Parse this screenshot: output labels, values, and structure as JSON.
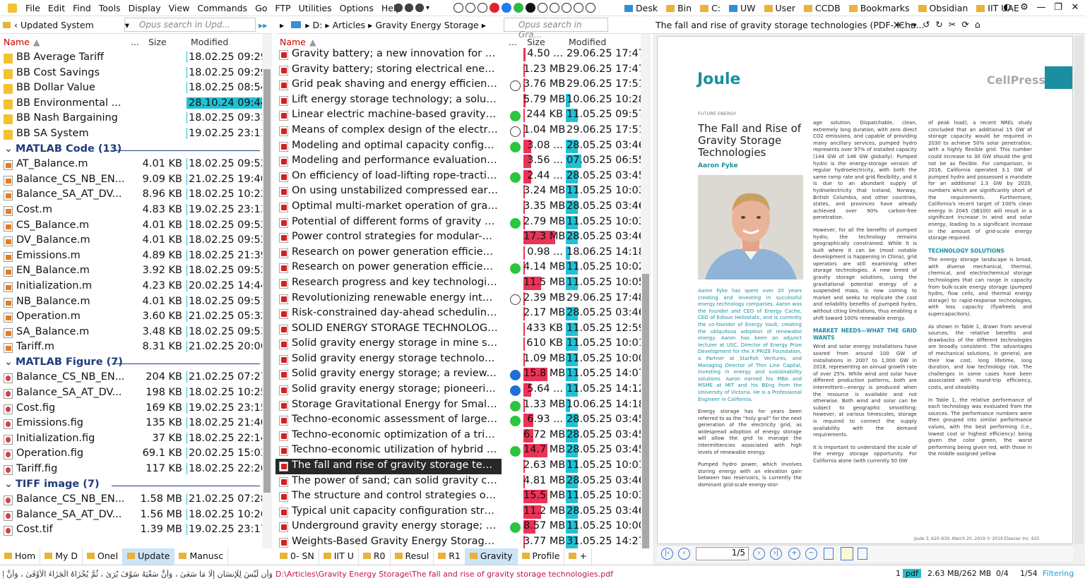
{
  "menubar": {
    "items": [
      "File",
      "Edit",
      "Find",
      "Tools",
      "Display",
      "View",
      "Commands",
      "Go",
      "FTP",
      "Utilities",
      "Options",
      "Help"
    ],
    "favorites": [
      "Desk",
      "Bin",
      "C:",
      "UW",
      "User",
      "CCDB",
      "Bookmarks",
      "Obsidian",
      "IIT UAE"
    ]
  },
  "left": {
    "breadcrumb": "Updated System",
    "search_placeholder": "Opus search in Upd...",
    "col_name": "Name",
    "col_dots": "...",
    "col_size": "Size",
    "col_modified": "Modified",
    "groups": [
      {
        "title": "",
        "rows": [
          {
            "name": "BB Average Tariff",
            "size": "",
            "mod": "18.02.25 09:29",
            "icon": "folder"
          },
          {
            "name": "BB Cost Savings",
            "size": "",
            "mod": "18.02.25 09:29",
            "icon": "folder"
          },
          {
            "name": "BB Dollar Value",
            "size": "",
            "mod": "18.02.25 08:54",
            "icon": "folder"
          },
          {
            "name": "BB Environmental ...",
            "size": "",
            "mod": "28.10.24 09:44",
            "icon": "folder",
            "hl": true
          },
          {
            "name": "BB Nash Bargaining",
            "size": "",
            "mod": "18.02.25 09:31",
            "icon": "folder"
          },
          {
            "name": "BB SA System",
            "size": "",
            "mod": "19.02.25 23:11",
            "icon": "folder"
          }
        ]
      },
      {
        "title": "MATLAB Code (13)",
        "rows": [
          {
            "name": "AT_Balance.m",
            "size": "4.01 KB",
            "mod": "18.02.25 09:52",
            "icon": "mfile"
          },
          {
            "name": "Balance_CS_NB_EN...",
            "size": "9.09 KB",
            "mod": "21.02.25 19:40",
            "icon": "mfile"
          },
          {
            "name": "Balance_SA_AT_DV...",
            "size": "8.96 KB",
            "mod": "18.02.25 10:22",
            "icon": "mfile"
          },
          {
            "name": "Cost.m",
            "size": "4.83 KB",
            "mod": "19.02.25 23:13",
            "icon": "mfile"
          },
          {
            "name": "CS_Balance.m",
            "size": "4.01 KB",
            "mod": "18.02.25 09:52",
            "icon": "mfile"
          },
          {
            "name": "DV_Balance.m",
            "size": "4.01 KB",
            "mod": "18.02.25 09:52",
            "icon": "mfile"
          },
          {
            "name": "Emissions.m",
            "size": "4.89 KB",
            "mod": "18.02.25 21:39",
            "icon": "mfile"
          },
          {
            "name": "EN_Balance.m",
            "size": "3.92 KB",
            "mod": "18.02.25 09:52",
            "icon": "mfile"
          },
          {
            "name": "Initialization.m",
            "size": "4.23 KB",
            "mod": "20.02.25 14:44",
            "icon": "mfile"
          },
          {
            "name": "NB_Balance.m",
            "size": "4.01 KB",
            "mod": "18.02.25 09:51",
            "icon": "mfile"
          },
          {
            "name": "Operation.m",
            "size": "3.60 KB",
            "mod": "21.02.25 05:32",
            "icon": "mfile"
          },
          {
            "name": "SA_Balance.m",
            "size": "3.48 KB",
            "mod": "18.02.25 09:53",
            "icon": "mfile"
          },
          {
            "name": "Tariff.m",
            "size": "8.31 KB",
            "mod": "21.02.25 20:06",
            "icon": "mfile"
          }
        ]
      },
      {
        "title": "MATLAB Figure (7)",
        "rows": [
          {
            "name": "Balance_CS_NB_EN...",
            "size": "204 KB",
            "mod": "21.02.25 07:27",
            "icon": "fig"
          },
          {
            "name": "Balance_SA_AT_DV...",
            "size": "198 KB",
            "mod": "18.02.25 10:25",
            "icon": "fig"
          },
          {
            "name": "Cost.fig",
            "size": "169 KB",
            "mod": "19.02.25 23:15",
            "icon": "fig"
          },
          {
            "name": "Emissions.fig",
            "size": "135 KB",
            "mod": "18.02.25 21:40",
            "icon": "fig"
          },
          {
            "name": "Initialization.fig",
            "size": "37 KB",
            "mod": "18.02.25 22:14",
            "icon": "fig"
          },
          {
            "name": "Operation.fig",
            "size": "69.1 KB",
            "mod": "20.02.25 15:03",
            "icon": "fig"
          },
          {
            "name": "Tariff.fig",
            "size": "117 KB",
            "mod": "18.02.25 22:26",
            "icon": "fig"
          }
        ]
      },
      {
        "title": "TIFF image (7)",
        "rows": [
          {
            "name": "Balance_CS_NB_EN...",
            "size": "1.58 MB",
            "mod": "21.02.25 07:28",
            "icon": "fig"
          },
          {
            "name": "Balance_SA_AT_DV...",
            "size": "1.56 MB",
            "mod": "18.02.25 10:26",
            "icon": "fig"
          },
          {
            "name": "Cost.tif",
            "size": "1.39 MB",
            "mod": "19.02.25 23:17",
            "icon": "fig"
          }
        ]
      }
    ],
    "tabs": [
      "Hom",
      "My D",
      "OneI",
      "Update",
      "Manusc"
    ]
  },
  "middle": {
    "breadcrumb": [
      "D:",
      "Articles",
      "Gravity Energy Storage"
    ],
    "search_placeholder": "Opus search in Gra...",
    "col_name": "Name",
    "col_dots": "...",
    "col_size": "Size",
    "col_modified": "Modified",
    "rows": [
      {
        "name": "Gravity battery; a new innovation for a su...",
        "tag": "",
        "size": "4.50 ...",
        "sizefill": 0.05,
        "mod": "29.06.25 17:47",
        "modfill": 0
      },
      {
        "name": "Gravity battery; storing electrical energy i...",
        "tag": "",
        "size": "1.23 MB",
        "sizefill": 0.02,
        "mod": "29.06.25 17:47",
        "modfill": 0
      },
      {
        "name": "Grid peak shaving and energy efficiency i...",
        "tag": "n",
        "size": "3.76 MB",
        "sizefill": 0.04,
        "mod": "29.06.25 17:51",
        "modfill": 0
      },
      {
        "name": "Lift energy storage technology; a solution...",
        "tag": "",
        "size": "5.79 MB",
        "sizefill": 0.05,
        "mod": "10.06.25 10:28",
        "modfill": 0.05
      },
      {
        "name": "Linear electric machine-based gravity ene...",
        "tag": "g",
        "size": "244 KB",
        "sizefill": 0,
        "mod": "11.05.25 09:57",
        "modfill": 0.15
      },
      {
        "name": "Means of complex design of the electrom...",
        "tag": "n",
        "size": "1.04 MB",
        "sizefill": 0.02,
        "mod": "29.06.25 17:51",
        "modfill": 0
      },
      {
        "name": "Modeling and optimal capacity configurat...",
        "tag": "g",
        "size": "3.08 ...",
        "sizefill": 0.2,
        "mod": "28.05.25 03:46",
        "modfill": 0.15
      },
      {
        "name": "Modeling and performance evaluation of ...",
        "tag": "",
        "size": "3.56 ...",
        "sizefill": 0.2,
        "mod": "07.05.25 06:55",
        "modfill": 0.2
      },
      {
        "name": "On efficiency of load-lifting rope-traction ...",
        "tag": "g",
        "size": "2.44 ...",
        "sizefill": 0.2,
        "mod": "28.05.25 03:45",
        "modfill": 0.15
      },
      {
        "name": "On using unstabilized compressed earth b...",
        "tag": "",
        "size": "3.24 MB",
        "sizefill": 0.03,
        "mod": "11.05.25 10:03",
        "modfill": 0.15
      },
      {
        "name": "Optimal multi-market operation of gravity...",
        "tag": "",
        "size": "3.35 MB",
        "sizefill": 0.03,
        "mod": "28.05.25 03:46",
        "modfill": 0.15
      },
      {
        "name": "Potential of different forms of gravity ene...",
        "tag": "g",
        "size": "2.79 MB",
        "sizefill": 0.03,
        "mod": "11.05.25 10:03",
        "modfill": 0.15
      },
      {
        "name": "Power control strategies for modular-gra...",
        "tag": "",
        "size": "17.3 MB",
        "sizefill": 0.8,
        "mod": "28.05.25 03:46",
        "modfill": 0.15
      },
      {
        "name": "Research on power generation efficiency ...",
        "tag": "",
        "size": "0.98 ...",
        "sizefill": 0,
        "mod": "18.06.25 14:18",
        "modfill": 0.05
      },
      {
        "name": "Research on power generation efficiency ...",
        "tag": "g",
        "size": "4.14 MB",
        "sizefill": 0.04,
        "mod": "11.05.25 10:02",
        "modfill": 0.15
      },
      {
        "name": "Research progress and key technologies i...",
        "tag": "",
        "size": "11.5 MB",
        "sizefill": 0.45,
        "mod": "11.05.25 10:05",
        "modfill": 0.15
      },
      {
        "name": "Revolutionizing renewable energy integr...",
        "tag": "n",
        "size": "2.39 MB",
        "sizefill": 0.03,
        "mod": "29.06.25 17:48",
        "modfill": 0
      },
      {
        "name": "Risk-constrained day-ahead scheduling fo...",
        "tag": "",
        "size": "2.17 MB",
        "sizefill": 0.03,
        "mod": "28.05.25 03:46",
        "modfill": 0.15
      },
      {
        "name": "SOLID ENERGY STORAGE TECHNOLOGIES...",
        "tag": "",
        "size": "433 KB",
        "sizefill": 0,
        "mod": "11.05.25 12:59",
        "modfill": 0.15
      },
      {
        "name": "Solid gravity energy storage in mine shaft...",
        "tag": "",
        "size": "610 KB",
        "sizefill": 0,
        "mod": "11.05.25 10:01",
        "modfill": 0.15
      },
      {
        "name": "Solid gravity energy storage technology C...",
        "tag": "",
        "size": "1.09 MB",
        "sizefill": 0.02,
        "mod": "11.05.25 10:00",
        "modfill": 0.15
      },
      {
        "name": "Solid gravity energy storage; a review.pdf",
        "tag": "b",
        "size": "15.8 MB",
        "sizefill": 0.6,
        "mod": "11.05.25 14:07",
        "modfill": 0.15
      },
      {
        "name": "Solid gravity energy storage; pioneering e...",
        "tag": "b",
        "size": "5.64 ...",
        "sizefill": 0.2,
        "mod": "11.05.25 14:12",
        "modfill": 0.15
      },
      {
        "name": "Storage Gravitational Energy for Small Sc...",
        "tag": "g",
        "size": "1.33 MB",
        "sizefill": 0.02,
        "mod": "10.06.25 14:18",
        "modfill": 0.05
      },
      {
        "name": "Techno-economic assessment of large-sca...",
        "tag": "g",
        "size": "6.93 ...",
        "sizefill": 0.25,
        "mod": "28.05.25 03:45",
        "modfill": 0.15
      },
      {
        "name": "Techno-economic optimization of a trigen...",
        "tag": "",
        "size": "6.72 MB",
        "sizefill": 0.25,
        "mod": "28.05.25 03:45",
        "modfill": 0.15
      },
      {
        "name": "Techno-economic utilization of hybrid opt...",
        "tag": "g",
        "size": "14.7 MB",
        "sizefill": 0.6,
        "mod": "28.05.25 03:45",
        "modfill": 0.15
      },
      {
        "name": "The fall and rise of gravity storage techno...",
        "tag": "",
        "size": "2.63 MB",
        "sizefill": 0.03,
        "mod": "11.05.25 10:01",
        "modfill": 0.15,
        "selected": true
      },
      {
        "name": "The power of sand; can solid gravity close...",
        "tag": "",
        "size": "4.81 MB",
        "sizefill": 0.04,
        "mod": "28.05.25 03:46",
        "modfill": 0.15
      },
      {
        "name": "The structure and control strategies of hy...",
        "tag": "",
        "size": "15.5 MB",
        "sizefill": 0.6,
        "mod": "11.05.25 10:03",
        "modfill": 0.15
      },
      {
        "name": "Typical unit capacity configuration strateg...",
        "tag": "",
        "size": "11.2 MB",
        "sizefill": 0.45,
        "mod": "28.05.25 03:46",
        "modfill": 0.15
      },
      {
        "name": "Underground gravity energy storage; a so...",
        "tag": "g",
        "size": "8.57 MB",
        "sizefill": 0.3,
        "mod": "11.05.25 10:00",
        "modfill": 0.15
      },
      {
        "name": "Weights-Based Gravity Energy Storage Lo...",
        "tag": "",
        "size": "3.77 MB",
        "sizefill": 0.04,
        "mod": "31.05.25 14:27",
        "modfill": 0.15
      }
    ],
    "tabs": [
      "0- SN",
      "IIT U",
      "R0",
      "Resul",
      "R1",
      "Gravity",
      "Profile",
      "+"
    ]
  },
  "viewer": {
    "title": "The fall and rise of gravity storage technologies (PDF-XCha...",
    "journal": "Joule",
    "publisher": "CellPress",
    "section": "FUTURE ENERGY",
    "paper_title": "The Fall and Rise of Gravity Storage Technologies",
    "author": "Aaron Fyke",
    "page_indicator": "1/5",
    "footer": "Joule 3, 620–630, March 20, 2019 © 2019 Elsevier Inc.     625",
    "bio": "Aaron Fyke has spent over 20 years creating and investing in successful energy technology companies. Aaron was the founder and CEO of Energy Cache, CEO of Edisun Heliostats, and is currently the co-founder of Energy Vault, creating the ubiquitous adoption of renewable energy. Aaron has been an adjunct lecturer at USC, Director of Energy Prize Development for the X PRIZE Foundation, a Partner at Starfish Ventures, and Managing Director of Thin Line Capital, investing in energy and sustainability solutions. Aaron earned his MBA and MSME at MIT and his BEng from the University of Victoria. He is a Professional Engineer in California.",
    "col_a1": "Energy storage has for years been referred to as the “holy grail” for the next generation of the electricity grid, as widespread adoption of energy storage will allow the grid to manage the intermittencies associated with high levels of renewable energy.",
    "col_a2": "Pumped hydro power, which involves storing energy with an elevation gain between two reservoirs, is currently the dominant grid-scale energy-stor-",
    "col_b1": "age solution. Dispatchable, clean, extremely long duration, with zero direct CO2 emissions, and capable of providing many ancillary services, pumped hydro represents over 97% of installed capacity (144 GW of 148 GW globally). Pumped hydro is the energy-storage version of regular hydroelectricity, with both the same ramp rate and grid flexibility, and it is due to an abundant supply of hydroelectricity that Iceland, Norway, British Columbia, and other countries, states, and provinces have already achieved over 90% carbon-free penetration.",
    "col_b2": "However, for all the benefits of pumped hydro, the technology remains geographically constrained. While it is built where it can be (most notable development is happening in China), grid operators are still examining other storage technologies. A new breed of gravity storage solutions, using the gravitational potential energy of a suspended mass, is now coming to market and seeks to replicate the cost and reliability benefits of pumped hydro, without citing limitations, thus enabling a shift toward 100% renewable energy.",
    "head_b": "MARKET NEEDS—WHAT THE GRID WANTS",
    "col_b3": "Wind and solar energy installations have soared from around 100 GW of installations in 2007 to 1,000 GW in 2018, representing an annual growth rate of over 25%. While wind and solar have different production patterns, both are intermittent—energy is produced when the resource is available and not otherwise. Both wind and solar can be subject to geographic smoothing; however, at various timescales, storage is required to connect the supply availability with the demand requirements.",
    "col_b4": "It is important to understand the scale of the energy storage opportunity. For California alone (with currently 50 GW",
    "col_c1": "of peak load), a recent NREL study concluded that an additional 15 GW of storage capacity would be required in 2030 to achieve 50% solar penetration, with a highly flexible grid. This number could increase to 30 GW should the grid not be as flexible. For comparison, in 2016, California operated 3.1 GW of pumped hydro and possessed a mandate for an additional 1.3 GW by 2020, numbers which are significantly short of the requirements. Furthermore, California's recent target of 100% clean energy in 2045 (SB100) will result in a significant increase in wind and solar energy, leading to a significant increase in the amount of grid-scale energy storage required.",
    "head_c": "TECHNOLOGY SOLUTIONS",
    "col_c2": "The energy storage landscape is broad, with diverse mechanical, thermal, chemical, and electrochemical storage technologies that can range in capacity from bulk-scale energy storage (pumped hydro, flow cells, and thermal energy storage) to rapid-response technologies, with less capacity (flywheels and supercapacitors).",
    "col_c3": "As shown in Table 1, drawn from several sources, the relative benefits and drawbacks of the different technologies are broadly consistent. The advantages of mechanical solutions, in general, are their low cost, long lifetime, long duration, and low technology risk. The challenges in some cases have been associated with round-trip efficiency, costs, and siteability.",
    "col_c4": "In Table 1, the relative performance of each technology was evaluated from the sources. The performance numbers were then grouped into similar performance values, with the best performing (i.e., lowest cost or highest efficiency) being given the color green, the worst performing being given red, with those in the middle assigned yellow."
  },
  "status": {
    "arabic": "وَأَن لَّيْسَ لِلْإِنسَانِ إِلَّا مَا سَعَىٰ ، وَأَنَّ سَعْيَهُ سَوْفَ يُرَىٰ ، ثُمَّ يُجْزَاهُ الْجَزَاءَ الْأَوْفَىٰ ، وَأَنَّ إِلَىٰ رَبِّكَ الْمُنتَهَىٰ",
    "path": "D:\\Articles\\Gravity Energy Storage\\The fall and rise of gravity storage technologies.pdf",
    "count1": "1",
    "type": "pdf",
    "size": "2.63 MB/262 MB",
    "sel": "0/4",
    "count2": "1/54",
    "filtering": "Filtering"
  }
}
